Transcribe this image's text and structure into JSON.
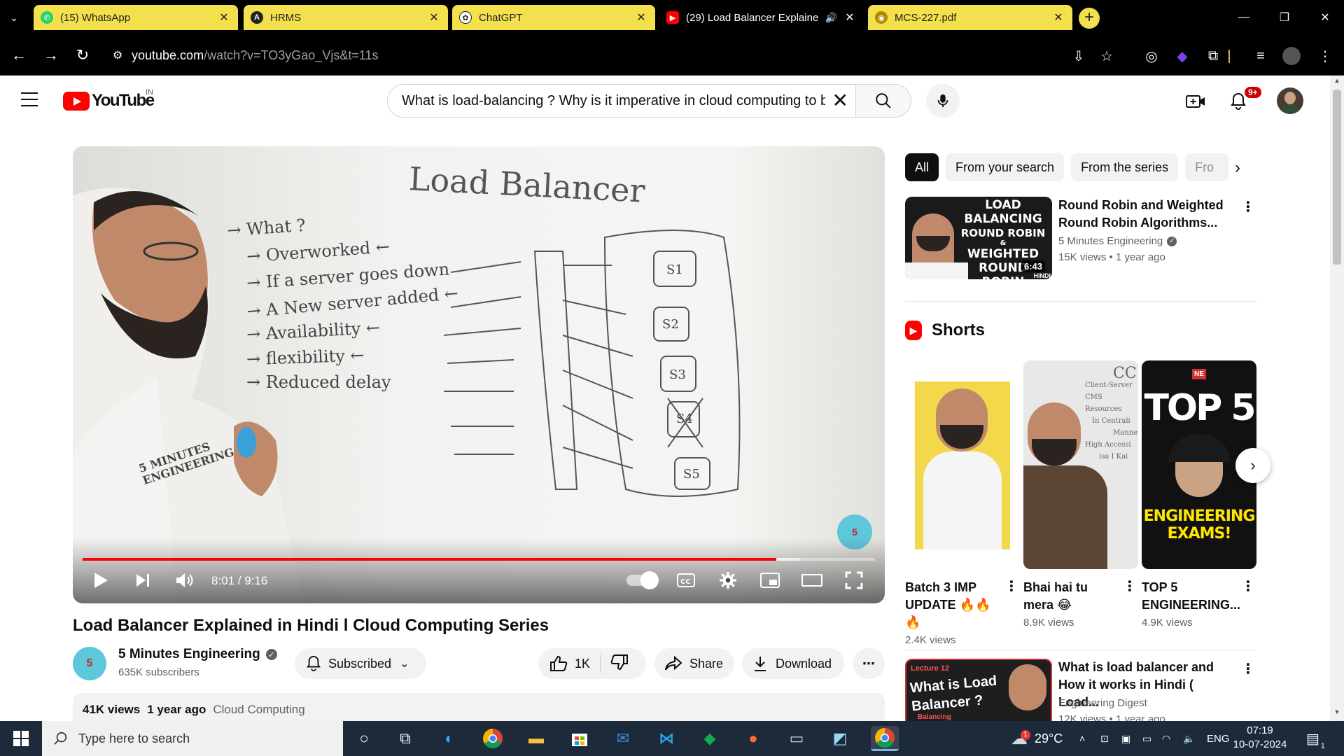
{
  "browser": {
    "tabs": [
      {
        "title": "(15) WhatsApp",
        "icon": "whatsapp-icon"
      },
      {
        "title": "HRMS",
        "icon": "hrms-icon"
      },
      {
        "title": "ChatGPT",
        "icon": "chatgpt-icon"
      },
      {
        "title": "(29) Load Balancer Explaine",
        "icon": "youtube-icon"
      },
      {
        "title": "MCS-227.pdf",
        "icon": "pdf-icon"
      }
    ],
    "url_host": "youtube.com",
    "url_rest": "/watch?v=TO3yGao_Vjs&t=11s"
  },
  "youtube": {
    "logo_text": "YouTube",
    "country_code": "IN",
    "search_value": "What is load-balancing ? Why is it imperative in cloud computing to balance the load",
    "notification_count": "9+"
  },
  "player": {
    "time": "8:01 / 9:16",
    "progress_fraction": 0.875,
    "board": {
      "heading": "Load Balancer",
      "items": [
        "What ?",
        "Overworked",
        "If a server goes down",
        "A New server added",
        "Availability",
        "flexibility",
        "Reduced delay"
      ],
      "servers": [
        "S1",
        "S2",
        "S3",
        "S4",
        "S5"
      ],
      "shirt": "5 MINUTES ENGINEERING"
    },
    "watermark": "5"
  },
  "video": {
    "title": "Load Balancer Explained in Hindi l Cloud Computing Series",
    "channel": "5 Minutes Engineering",
    "subscribers": "635K subscribers",
    "subscribed_label": "Subscribed",
    "likes": "1K",
    "share_label": "Share",
    "download_label": "Download",
    "views": "41K views",
    "age": "1 year ago",
    "tag": "Cloud Computing"
  },
  "sidebar": {
    "chips": [
      "All",
      "From your search",
      "From the series",
      "Fro"
    ],
    "recommendations": [
      {
        "title": "Round Robin and Weighted Round Robin Algorithms...",
        "channel": "5 Minutes Engineering",
        "meta": "15K views  •  1 year ago",
        "duration": "6:43",
        "thumb_text": [
          "LOAD BALANCING",
          "ROUND ROBIN",
          "&",
          "WEIGHTED",
          "ROUND ROBIN"
        ],
        "thumb_corner": "HINDI"
      },
      {
        "title": "What is load balancer and How it works in Hindi ( Load...",
        "channel": "Engineering Digest",
        "meta": "12K views  •  1 year ago",
        "thumb_text": [
          "Lecture 12",
          "What is Load",
          "Balancer ?",
          "Balancing"
        ]
      }
    ],
    "shorts_heading": "Shorts",
    "shorts": [
      {
        "title": "Batch 3 IMP UPDATE 🔥🔥🔥",
        "views": "2.4K views"
      },
      {
        "title": "Bhai hai tu mera 😂",
        "views": "8.9K views",
        "board_lines": [
          "CC",
          "Client-Server",
          "CMS",
          "Resources",
          "In",
          "Centrali",
          "Manner",
          "High Accessi",
          "isa I Kai"
        ]
      },
      {
        "title": "TOP 5 ENGINEERING...",
        "views": "4.9K views",
        "thumb_top": "TOP 5",
        "thumb_bottom": "ENGINEERING EXAMS!",
        "badge": "NE"
      }
    ]
  },
  "taskbar": {
    "search_placeholder": "Type here to search",
    "weather": "29°C",
    "weather_badge": "1",
    "language": "ENG",
    "time": "07:19",
    "date": "10-07-2024",
    "notification_count": "1"
  },
  "colors": {
    "youtube_red": "#ff0000",
    "tab_yellow": "#f4e04d",
    "taskbar": "#1c2a3a"
  }
}
